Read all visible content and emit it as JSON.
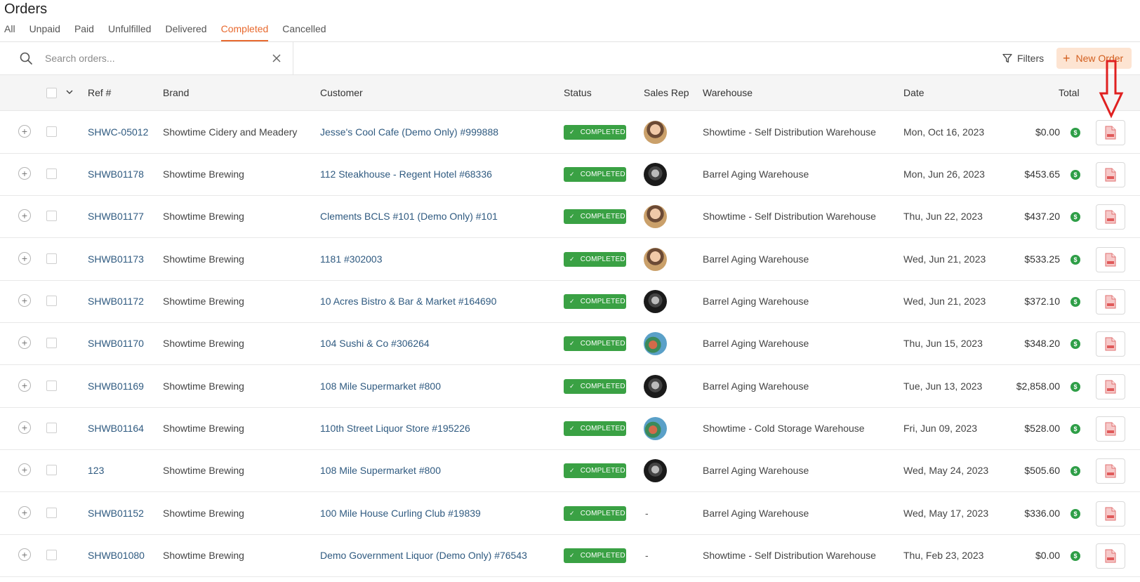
{
  "page": {
    "title": "Orders"
  },
  "tabs": [
    {
      "label": "All",
      "active": false
    },
    {
      "label": "Unpaid",
      "active": false
    },
    {
      "label": "Paid",
      "active": false
    },
    {
      "label": "Unfulfilled",
      "active": false
    },
    {
      "label": "Delivered",
      "active": false
    },
    {
      "label": "Completed",
      "active": true
    },
    {
      "label": "Cancelled",
      "active": false
    }
  ],
  "search": {
    "placeholder": "Search orders...",
    "value": ""
  },
  "toolbar": {
    "filters_label": "Filters",
    "new_order_label": "New Order"
  },
  "table": {
    "columns": {
      "ref": "Ref #",
      "brand": "Brand",
      "customer": "Customer",
      "status": "Status",
      "sales_rep": "Sales Rep",
      "warehouse": "Warehouse",
      "date": "Date",
      "total": "Total"
    },
    "rows": [
      {
        "ref": "SHWC-05012",
        "brand": "Showtime Cidery and Meadery",
        "customer": "Jesse's Cool Cafe (Demo Only) #999888",
        "status": "COMPLETED",
        "sales_rep": "rep-a",
        "warehouse": "Showtime - Self Distribution Warehouse",
        "date": "Mon, Oct 16, 2023",
        "total": "$0.00"
      },
      {
        "ref": "SHWB01178",
        "brand": "Showtime Brewing",
        "customer": "112 Steakhouse - Regent Hotel #68336",
        "status": "COMPLETED",
        "sales_rep": "rep-b",
        "warehouse": "Barrel Aging Warehouse",
        "date": "Mon, Jun 26, 2023",
        "total": "$453.65"
      },
      {
        "ref": "SHWB01177",
        "brand": "Showtime Brewing",
        "customer": "Clements BCLS #101 (Demo Only) #101",
        "status": "COMPLETED",
        "sales_rep": "rep-a",
        "warehouse": "Showtime - Self Distribution Warehouse",
        "date": "Thu, Jun 22, 2023",
        "total": "$437.20"
      },
      {
        "ref": "SHWB01173",
        "brand": "Showtime Brewing",
        "customer": "1181 #302003",
        "status": "COMPLETED",
        "sales_rep": "rep-a",
        "warehouse": "Barrel Aging Warehouse",
        "date": "Wed, Jun 21, 2023",
        "total": "$533.25"
      },
      {
        "ref": "SHWB01172",
        "brand": "Showtime Brewing",
        "customer": "10 Acres Bistro & Bar & Market #164690",
        "status": "COMPLETED",
        "sales_rep": "rep-b",
        "warehouse": "Barrel Aging Warehouse",
        "date": "Wed, Jun 21, 2023",
        "total": "$372.10"
      },
      {
        "ref": "SHWB01170",
        "brand": "Showtime Brewing",
        "customer": "104 Sushi & Co #306264",
        "status": "COMPLETED",
        "sales_rep": "rep-c",
        "warehouse": "Barrel Aging Warehouse",
        "date": "Thu, Jun 15, 2023",
        "total": "$348.20"
      },
      {
        "ref": "SHWB01169",
        "brand": "Showtime Brewing",
        "customer": "108 Mile Supermarket #800",
        "status": "COMPLETED",
        "sales_rep": "rep-b",
        "warehouse": "Barrel Aging Warehouse",
        "date": "Tue, Jun 13, 2023",
        "total": "$2,858.00"
      },
      {
        "ref": "SHWB01164",
        "brand": "Showtime Brewing",
        "customer": "110th Street Liquor Store #195226",
        "status": "COMPLETED",
        "sales_rep": "rep-c",
        "warehouse": "Showtime - Cold Storage Warehouse",
        "date": "Fri, Jun 09, 2023",
        "total": "$528.00"
      },
      {
        "ref": "123",
        "brand": "Showtime Brewing",
        "customer": "108 Mile Supermarket #800",
        "status": "COMPLETED",
        "sales_rep": "rep-b",
        "warehouse": "Barrel Aging Warehouse",
        "date": "Wed, May 24, 2023",
        "total": "$505.60"
      },
      {
        "ref": "SHWB01152",
        "brand": "Showtime Brewing",
        "customer": "100 Mile House Curling Club #19839",
        "status": "COMPLETED",
        "sales_rep": "-",
        "warehouse": "Barrel Aging Warehouse",
        "date": "Wed, May 17, 2023",
        "total": "$336.00"
      },
      {
        "ref": "SHWB01080",
        "brand": "Showtime Brewing",
        "customer": "Demo Government Liquor (Demo Only) #76543",
        "status": "COMPLETED",
        "sales_rep": "-",
        "warehouse": "Showtime - Self Distribution Warehouse",
        "date": "Thu, Feb 23, 2023",
        "total": "$0.00"
      }
    ]
  },
  "icons": {
    "search": "search-icon",
    "clear": "close-icon",
    "filter": "filter-icon",
    "plus": "plus-icon",
    "expand": "plus-circle-icon",
    "sort": "chevron-down-icon",
    "check": "check-icon",
    "payment": "dollar-icon",
    "pdf": "pdf-file-icon",
    "annotation": "arrow-down-icon"
  },
  "colors": {
    "accent": "#e8692e",
    "link": "#2f5a80",
    "status_completed": "#3aa144",
    "paid_indicator": "#2e9e47",
    "new_order_bg": "#fde4d2",
    "annotation_arrow": "#e02020"
  }
}
